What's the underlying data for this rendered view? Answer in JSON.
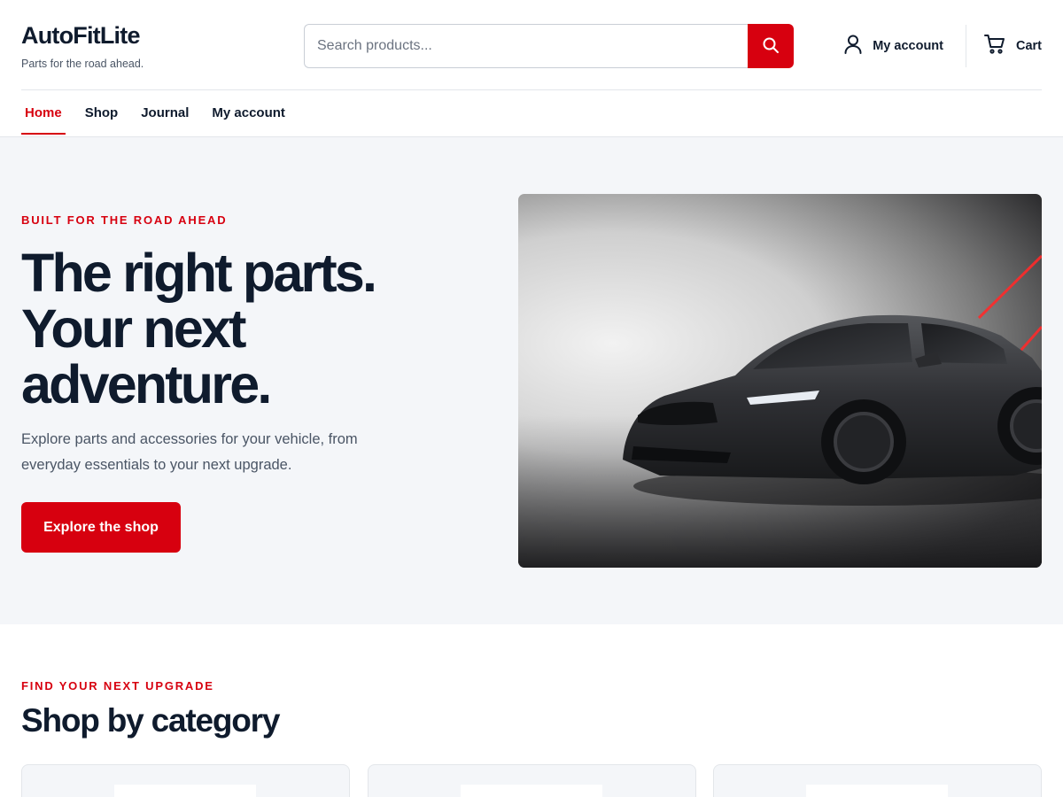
{
  "brand": {
    "name": "AutoFitLite",
    "tagline": "Parts for the road ahead."
  },
  "search": {
    "placeholder": "Search products...",
    "button_icon": "search-icon"
  },
  "header_links": {
    "account_label": "My account",
    "account_icon": "user-icon",
    "cart_label": "Cart",
    "cart_icon": "cart-icon"
  },
  "nav": {
    "items": [
      {
        "label": "Home",
        "active": true
      },
      {
        "label": "Shop",
        "active": false
      },
      {
        "label": "Journal",
        "active": false
      },
      {
        "label": "My account",
        "active": false
      }
    ]
  },
  "hero": {
    "eyebrow": "BUILT FOR THE ROAD AHEAD",
    "title_lines": [
      "The right parts.",
      "Your next",
      "adventure."
    ],
    "description": "Explore parts and accessories for your vehicle, from everyday essentials to your next upgrade.",
    "cta_label": "Explore the shop"
  },
  "categories": {
    "eyebrow": "FIND YOUR NEXT UPGRADE",
    "title": "Shop by category",
    "card_count_visible": 3
  },
  "colors": {
    "accent": "#d7000f",
    "text_dark": "#0f1b2d",
    "text_muted": "#4a5565",
    "hero_bg": "#f4f6f9",
    "border": "#e3e6ea"
  }
}
